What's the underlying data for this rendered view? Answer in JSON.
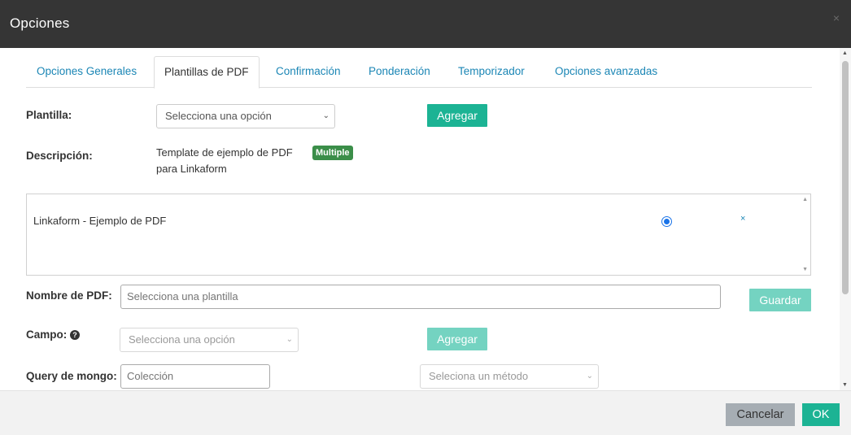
{
  "header": {
    "title": "Opciones",
    "close_icon": "×"
  },
  "tabs": [
    {
      "label": "Opciones Generales",
      "active": false
    },
    {
      "label": "Plantillas de PDF",
      "active": true
    },
    {
      "label": "Confirmación",
      "active": false
    },
    {
      "label": "Ponderación",
      "active": false
    },
    {
      "label": "Temporizador",
      "active": false
    },
    {
      "label": "Opciones avanzadas",
      "active": false
    }
  ],
  "form": {
    "plantilla_label": "Plantilla:",
    "plantilla_select": "Selecciona una opción",
    "agregar_label": "Agregar",
    "descripcion_label": "Descripción:",
    "descripcion_line1": "Template de ejemplo de PDF",
    "descripcion_line2": "para Linkaform",
    "badge": "Multiple",
    "list_item": "Linkaform - Ejemplo de PDF",
    "remove_icon": "×",
    "nombre_pdf_label": "Nombre de PDF:",
    "nombre_pdf_placeholder": "Selecciona una plantilla",
    "guardar_label": "Guardar",
    "campo_label": "Campo:",
    "help_icon": "?",
    "campo_select": "Selecciona una opción",
    "agregar2_label": "Agregar",
    "query_label": "Query de mongo:",
    "coleccion_placeholder": "Colección",
    "metodo_select": "Seleciona un método"
  },
  "footer": {
    "cancel_label": "Cancelar",
    "ok_label": "OK"
  },
  "colors": {
    "header_bg": "#353535",
    "primary": "#1cb394",
    "link": "#1b86b5",
    "badge": "#3b8e49",
    "cancel_bg": "#a6adb3"
  }
}
